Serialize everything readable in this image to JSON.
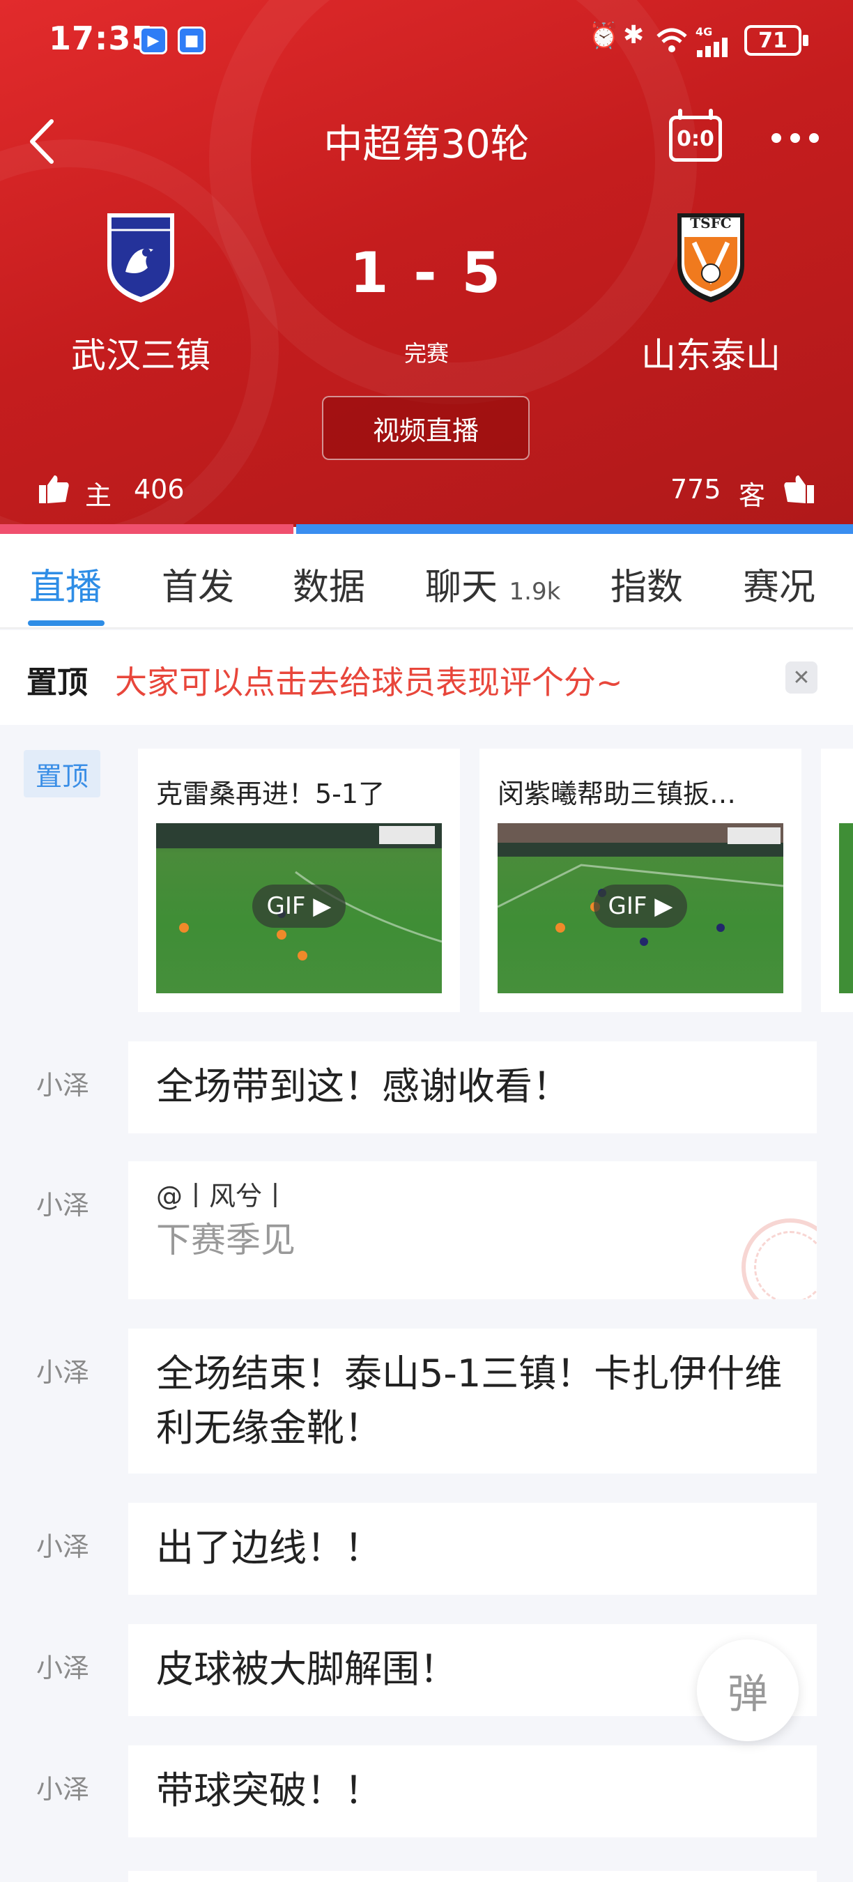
{
  "status_bar": {
    "time": "17:35",
    "network": "4G",
    "battery": "71"
  },
  "nav": {
    "title": "中超第30轮",
    "scoreboard_icon_label": "0:0"
  },
  "match": {
    "home": {
      "name": "武汉三镇",
      "likes_label": "主",
      "likes": "406"
    },
    "away": {
      "name": "山东泰山",
      "likes_label": "客",
      "likes": "775",
      "badge_text": "TSFC"
    },
    "score": "1 - 5",
    "state": "完赛",
    "video_button": "视频直播",
    "support_share": {
      "home": 0.344,
      "away": 0.656
    }
  },
  "tabs": [
    {
      "label": "直播",
      "badge": "",
      "active": true
    },
    {
      "label": "首发",
      "badge": ""
    },
    {
      "label": "数据",
      "badge": ""
    },
    {
      "label": "聊天",
      "badge": "1.9k"
    },
    {
      "label": "指数",
      "badge": ""
    },
    {
      "label": "赛况",
      "badge": ""
    }
  ],
  "pinned_notice": {
    "tag": "置顶",
    "text": "大家可以点击去给球员表现评个分~"
  },
  "highlights": {
    "tag": "置顶",
    "cards": [
      {
        "title": "克雷桑再进！5-1了",
        "badge": "GIF"
      },
      {
        "title": "闵紫曦帮助三镇扳…",
        "badge": "GIF"
      }
    ]
  },
  "messages": [
    {
      "author": "小泽",
      "text": "全场带到这！感谢收看！"
    },
    {
      "author": "小泽",
      "quote": "@丨风兮丨",
      "text": "下赛季见"
    },
    {
      "author": "小泽",
      "text": "全场结束！泰山5-1三镇！卡扎伊什维利无缘金靴！"
    },
    {
      "author": "小泽",
      "text": "出了边线！！"
    },
    {
      "author": "小泽",
      "text": "皮球被大脚解围！"
    },
    {
      "author": "小泽",
      "text": "带球突破！！"
    }
  ],
  "danmu_button": "弹",
  "colors": {
    "header_red": "#c81f20",
    "accent_blue": "#2e8de6",
    "notice_red": "#e8463b",
    "home_bar": "#f0506e",
    "away_bar": "#3a8ef0"
  }
}
